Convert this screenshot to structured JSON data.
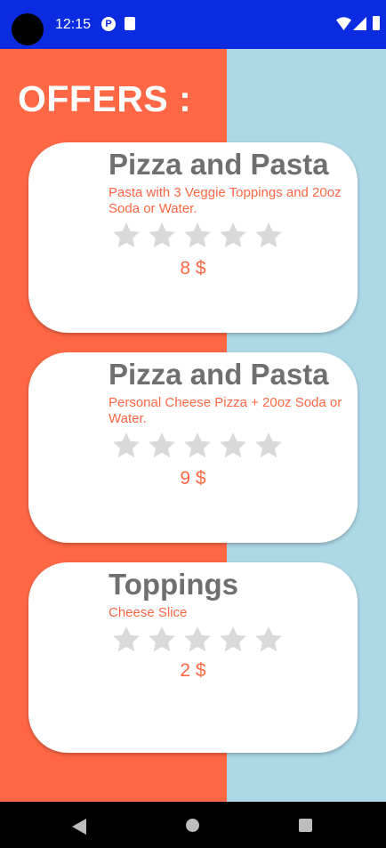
{
  "status_bar": {
    "time": "12:15",
    "icons": [
      "camera-cutout",
      "data-saver-icon",
      "sd-card-icon",
      "wifi-icon",
      "signal-icon",
      "battery-icon"
    ]
  },
  "page": {
    "title": "OFFERS :"
  },
  "colors": {
    "status_bar": "#0a2be0",
    "left_panel": "#ff6745",
    "right_panel": "#add8e6",
    "accent": "#ff6745",
    "title_text": "#6f6f6f",
    "star_empty": "#d9d9d9"
  },
  "offers": [
    {
      "title": "Pizza and Pasta",
      "description": "Pasta with 3 Veggie Toppings and 20oz Soda or Water.",
      "rating": 0,
      "rating_max": 5,
      "price": "8 $"
    },
    {
      "title": "Pizza and Pasta",
      "description": "Personal Cheese Pizza + 20oz Soda or Water.",
      "rating": 0,
      "rating_max": 5,
      "price": "9 $"
    },
    {
      "title": "Toppings",
      "description": "Cheese Slice",
      "rating": 0,
      "rating_max": 5,
      "price": "2 $"
    }
  ],
  "nav_bar": {
    "buttons": [
      "back-icon",
      "home-icon",
      "recents-icon"
    ]
  }
}
